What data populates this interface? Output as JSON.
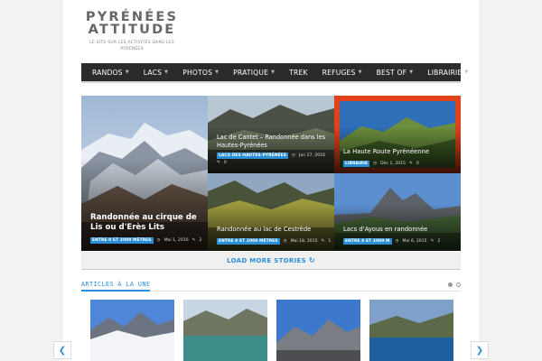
{
  "site": {
    "title_line1": "PYRÉNÉES",
    "title_line2": "ATTITUDE",
    "tagline": "LE SITE SUR LES ACTIVITÉS DANS LES PYRÉNÉES"
  },
  "nav": {
    "items": [
      {
        "label": "RANDOS",
        "dropdown": true
      },
      {
        "label": "LACS",
        "dropdown": true
      },
      {
        "label": "PHOTOS",
        "dropdown": true
      },
      {
        "label": "PRATIQUE",
        "dropdown": true
      },
      {
        "label": "TREK",
        "dropdown": false
      },
      {
        "label": "REFUGES",
        "dropdown": true
      },
      {
        "label": "BEST OF",
        "dropdown": true
      },
      {
        "label": "LIBRAIRIE",
        "dropdown": true
      }
    ]
  },
  "featured": {
    "big": {
      "title": "Randonnée au cirque de Lis ou d'Erès Lits",
      "category": "ENTRE 0 ET 2000 MÈTRES",
      "date": "Mai 1, 2016",
      "comments": "2"
    },
    "tiles": [
      {
        "title": "Lac de Cantet – Randonnée dans les Hautes-Pyrénées",
        "category": "LACS DES HAUTES-PYRÉNÉES",
        "date": "Jan 27, 2016",
        "comments": "0"
      },
      {
        "title": "La Haute Route Pyrénéenne",
        "category": "LIBRAIRIE",
        "date": "Déc 1, 2015",
        "comments": "0"
      },
      {
        "title": "Randonnée au lac de Cestrède",
        "category": "ENTRE 0 ET 2000 MÈTRES",
        "date": "Mai 18, 2015",
        "comments": "1"
      },
      {
        "title": "Lacs d'Ayous en randonnée",
        "category": "ENTRE 0 ET 2000 M",
        "date": "Mai 6, 2015",
        "comments": "2"
      }
    ]
  },
  "load_more": {
    "label": "LOAD MORE STORIES",
    "icon": "refresh-icon"
  },
  "section": {
    "title": "ARTICLES À LA UNE"
  },
  "carousel": {
    "prev_icon": "chevron-left-icon",
    "next_icon": "chevron-right-icon"
  },
  "colors": {
    "accent": "#2a8fd6",
    "nav_bg": "#2b2b2b",
    "tile_border_red": "#e0431c"
  }
}
